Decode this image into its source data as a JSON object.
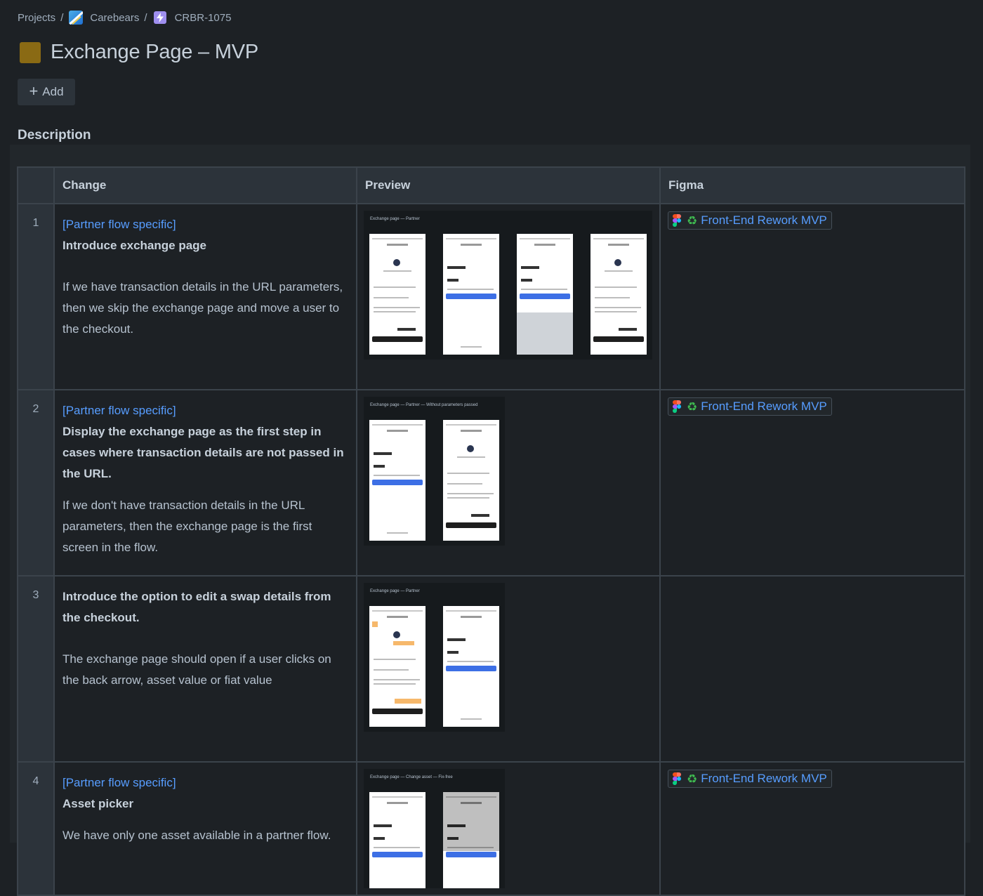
{
  "breadcrumb": {
    "projects": "Projects",
    "separator": "/",
    "project": "Carebears",
    "issue_key": "CRBR-1075"
  },
  "page": {
    "title": "Exchange Page – MVP",
    "add_label": "Add",
    "description_heading": "Description"
  },
  "table": {
    "headers": {
      "num": "",
      "change": "Change",
      "preview": "Preview",
      "figma": "Figma"
    },
    "rows": [
      {
        "num": "1",
        "tag": "[Partner flow specific]",
        "heading": "Introduce exchange page",
        "body": "If we have transaction details in the URL parameters, then we skip the exchange page and move a user to the checkout.",
        "preview_caption": "Exchange page — Partner",
        "figma_label": "Front-End Rework MVP"
      },
      {
        "num": "2",
        "tag": "[Partner flow specific]",
        "heading": "Display the exchange page as the first step in cases where transaction details are not passed in the URL.",
        "body": "If we don't have transaction details in the URL parameters, then the exchange page is the first screen in the flow.",
        "preview_caption": "Exchange page — Partner — Without parameters passed",
        "figma_label": "Front-End Rework MVP"
      },
      {
        "num": "3",
        "heading": "Introduce the option to edit a swap details from the checkout.",
        "body": "The exchange page should open if a user clicks on the back arrow, asset value or fiat value",
        "preview_caption": "Exchange page — Partner"
      },
      {
        "num": "4",
        "tag": "[Partner flow specific]",
        "heading": "Asset picker",
        "body": "We have only one asset available in a partner flow.",
        "preview_caption": "Exchange page — Change asset — Fix-free",
        "figma_label": "Front-End Rework MVP"
      }
    ]
  },
  "colors": {
    "background": "#1d2125",
    "link": "#579dff",
    "epic": "#9f8fef",
    "title_swatch": "#8a6a14"
  },
  "icons": {
    "project": "project-avatar-icon",
    "issue": "epic-icon",
    "add": "plus-icon",
    "figma": "figma-icon",
    "recycle": "recycle-icon"
  }
}
